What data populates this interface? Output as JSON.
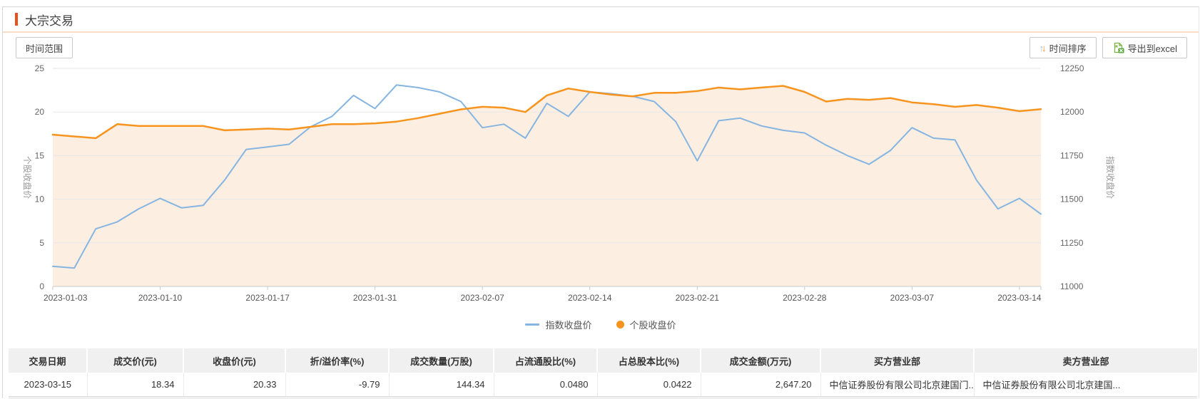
{
  "header": {
    "title": "大宗交易"
  },
  "toolbar": {
    "time_range_label": "时间范围",
    "sort_label": "时间排序",
    "export_label": "导出到excel"
  },
  "colors": {
    "accent": "#e8501e",
    "title_divider": "#fbddc6",
    "index_line": "#85b5e0",
    "stock_line": "#f7941e",
    "stock_area": "#fdeee2",
    "table_header_bg": "#f0f0f0"
  },
  "chart_data": {
    "type": "line",
    "x": [
      "2023-01-03",
      "2023-01-04",
      "2023-01-05",
      "2023-01-06",
      "2023-01-09",
      "2023-01-10",
      "2023-01-11",
      "2023-01-12",
      "2023-01-13",
      "2023-01-16",
      "2023-01-17",
      "2023-01-18",
      "2023-01-19",
      "2023-01-20",
      "2023-01-30",
      "2023-01-31",
      "2023-02-01",
      "2023-02-02",
      "2023-02-03",
      "2023-02-06",
      "2023-02-07",
      "2023-02-08",
      "2023-02-09",
      "2023-02-10",
      "2023-02-13",
      "2023-02-14",
      "2023-02-15",
      "2023-02-16",
      "2023-02-17",
      "2023-02-20",
      "2023-02-21",
      "2023-02-22",
      "2023-02-23",
      "2023-02-24",
      "2023-02-27",
      "2023-02-28",
      "2023-03-01",
      "2023-03-02",
      "2023-03-03",
      "2023-03-06",
      "2023-03-07",
      "2023-03-08",
      "2023-03-09",
      "2023-03-10",
      "2023-03-13",
      "2023-03-14",
      "2023-03-15"
    ],
    "x_tick_indices": [
      0,
      5,
      10,
      15,
      20,
      25,
      30,
      35,
      40,
      45
    ],
    "x_tick_labels": [
      "2023-01-03",
      "2023-01-10",
      "2023-01-17",
      "2023-01-31",
      "2023-02-07",
      "2023-02-14",
      "2023-02-21",
      "2023-02-28",
      "2023-03-07",
      "2023-03-14"
    ],
    "left_axis": {
      "title": "个股收盘价",
      "min": 0,
      "max": 25,
      "ticks": [
        0,
        5,
        10,
        15,
        20,
        25
      ]
    },
    "right_axis": {
      "title": "指数收盘价",
      "min": 11000,
      "max": 12250,
      "ticks": [
        11000,
        11250,
        11500,
        11750,
        12000,
        12250
      ]
    },
    "grid": true,
    "legend_position": "bottom-center",
    "series": [
      {
        "name": "指数收盘价",
        "axis": "right",
        "marker": "line",
        "color": "#85b5e0",
        "values": [
          11115,
          11105,
          11330,
          11370,
          11445,
          11505,
          11450,
          11465,
          11610,
          11785,
          11800,
          11815,
          11915,
          11975,
          12095,
          12020,
          12155,
          12140,
          12115,
          12060,
          11910,
          11930,
          11850,
          12050,
          11975,
          12115,
          12105,
          12090,
          12060,
          11945,
          11720,
          11950,
          11965,
          11920,
          11895,
          11880,
          11810,
          11750,
          11700,
          11780,
          11910,
          11850,
          11840,
          11610,
          11445,
          11505,
          11415
        ]
      },
      {
        "name": "个股收盘价",
        "axis": "left",
        "marker": "circle",
        "color": "#f7941e",
        "area": true,
        "area_color": "#fdeee2",
        "values": [
          17.4,
          17.2,
          17.0,
          18.6,
          18.4,
          18.4,
          18.4,
          18.4,
          17.9,
          18.0,
          18.1,
          18.0,
          18.3,
          18.6,
          18.6,
          18.7,
          18.9,
          19.3,
          19.8,
          20.3,
          20.6,
          20.5,
          20.0,
          21.9,
          22.7,
          22.3,
          22.0,
          21.8,
          22.2,
          22.2,
          22.4,
          22.8,
          22.6,
          22.8,
          23.0,
          22.3,
          21.2,
          21.5,
          21.4,
          21.6,
          21.1,
          20.9,
          20.6,
          20.8,
          20.5,
          20.1,
          20.33
        ]
      }
    ]
  },
  "table": {
    "headers": [
      "交易日期",
      "成交价(元)",
      "收盘价(元)",
      "折/溢价率(%)",
      "成交数量(万股)",
      "占流通股比(%)",
      "占总股本比(%)",
      "成交金额(万元)",
      "买方营业部",
      "卖方营业部"
    ],
    "rows": [
      [
        "2023-03-15",
        "18.34",
        "20.33",
        "-9.79",
        "144.34",
        "0.0480",
        "0.0422",
        "2,647.20",
        "中信证券股份有限公司北京建国门...",
        "中信证券股份有限公司北京建国..."
      ]
    ]
  }
}
